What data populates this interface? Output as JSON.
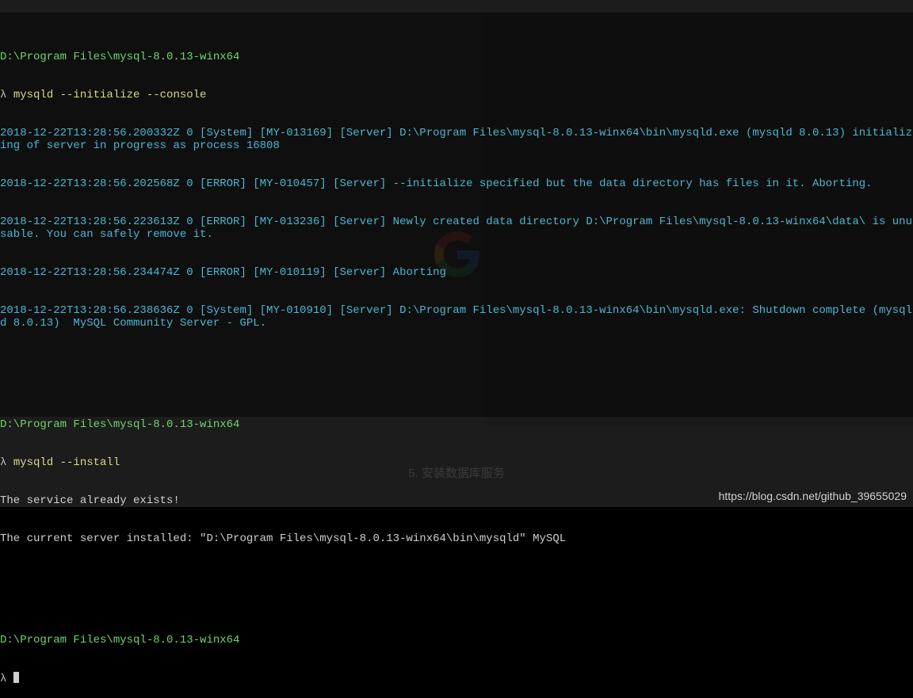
{
  "terminal": {
    "path1": "D:\\Program Files\\mysql-8.0.13-winx64",
    "prompt1_lambda": "λ",
    "cmd1": "mysqld --initialize --console",
    "log1": "2018-12-22T13:28:56.200332Z 0 [System] [MY-013169] [Server] D:\\Program Files\\mysql-8.0.13-winx64\\bin\\mysqld.exe (mysqld 8.0.13) initializing of server in progress as process 16808",
    "log2": "2018-12-22T13:28:56.202568Z 0 [ERROR] [MY-010457] [Server] --initialize specified but the data directory has files in it. Aborting.",
    "log3": "2018-12-22T13:28:56.223613Z 0 [ERROR] [MY-013236] [Server] Newly created data directory D:\\Program Files\\mysql-8.0.13-winx64\\data\\ is unusable. You can safely remove it.",
    "log4": "2018-12-22T13:28:56.234474Z 0 [ERROR] [MY-010119] [Server] Aborting",
    "log5": "2018-12-22T13:28:56.238636Z 0 [System] [MY-010910] [Server] D:\\Program Files\\mysql-8.0.13-winx64\\bin\\mysqld.exe: Shutdown complete (mysqld 8.0.13)  MySQL Community Server - GPL.",
    "path2": "D:\\Program Files\\mysql-8.0.13-winx64",
    "prompt2_lambda": "λ",
    "cmd2": "mysqld --install",
    "out1": "The service already exists!",
    "out2": "The current server installed: \"D:\\Program Files\\mysql-8.0.13-winx64\\bin\\mysqld\" MySQL",
    "path3": "D:\\Program Files\\mysql-8.0.13-winx64",
    "prompt3_lambda": "λ"
  },
  "background": {
    "caption": "5. 安装数据库服务"
  },
  "watermark": "https://blog.csdn.net/github_39655029"
}
